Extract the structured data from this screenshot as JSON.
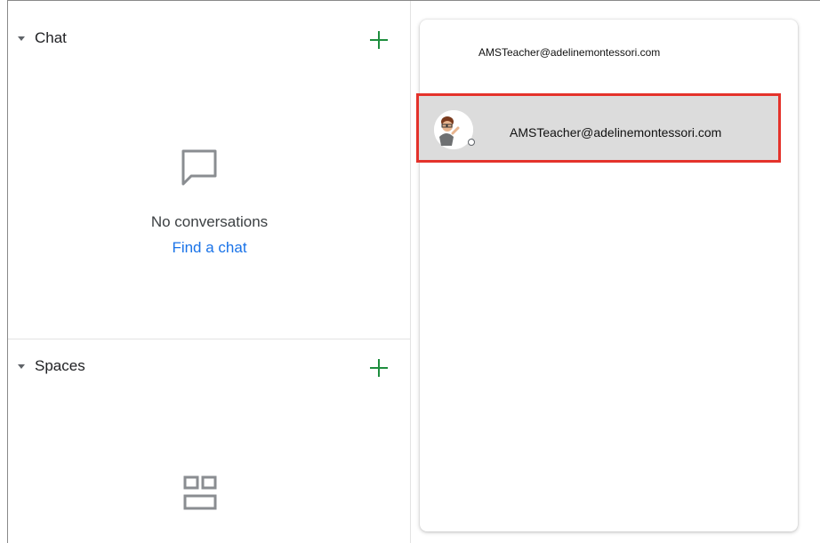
{
  "chat": {
    "title": "Chat",
    "empty_text": "No conversations",
    "find_link": "Find a chat"
  },
  "spaces": {
    "title": "Spaces"
  },
  "account_menu": {
    "top_email": "AMSTeacher@adelinemontessori.com",
    "selected_account_email": "AMSTeacher@adelinemontessori.com"
  },
  "colors": {
    "add_button": "#1e8e3e",
    "link": "#1a73e8",
    "highlight_border": "#e4322b"
  },
  "icons": {
    "caret": "caret-down-icon",
    "add": "plus-icon",
    "chat_empty": "chat-bubble-icon",
    "spaces_empty": "spaces-grid-icon",
    "status": "status-dot-icon"
  }
}
